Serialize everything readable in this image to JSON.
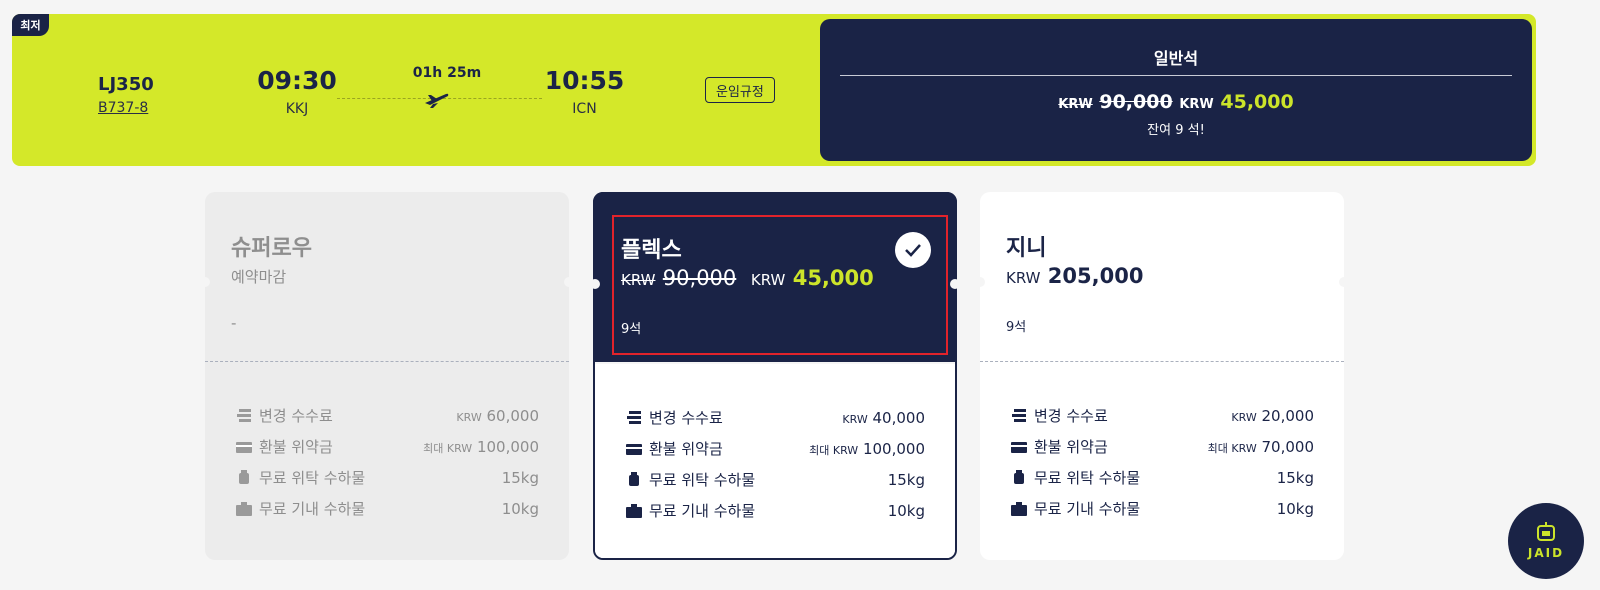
{
  "flight": {
    "badge": "최저",
    "flight_no": "LJ350",
    "aircraft": "B737-8",
    "departure": {
      "time": "09:30",
      "code": "KKJ"
    },
    "arrival": {
      "time": "10:55",
      "code": "ICN"
    },
    "duration": "01h 25m",
    "rules_label": "운임규정"
  },
  "economy": {
    "title": "일반석",
    "currency": "KRW",
    "original_price": "90,000",
    "sale_price": "45,000",
    "seats_left": "잔여 9 석!"
  },
  "fares": [
    {
      "name": "슈퍼로우",
      "status": "예약마감",
      "seats": "-",
      "rows": [
        {
          "label": "변경 수수료",
          "prefix": "",
          "currency": "KRW",
          "value": "60,000"
        },
        {
          "label": "환불 위약금",
          "prefix": "최대 ",
          "currency": "KRW",
          "value": "100,000"
        },
        {
          "label": "무료 위탁 수하물",
          "prefix": "",
          "currency": "",
          "value": "15kg"
        },
        {
          "label": "무료 기내 수하물",
          "prefix": "",
          "currency": "",
          "value": "10kg"
        }
      ]
    },
    {
      "name": "플렉스",
      "currency": "KRW",
      "original_price": "90,000",
      "sale_price": "45,000",
      "seats": "9석",
      "selected": true,
      "rows": [
        {
          "label": "변경 수수료",
          "prefix": "",
          "currency": "KRW",
          "value": "40,000"
        },
        {
          "label": "환불 위약금",
          "prefix": "최대 ",
          "currency": "KRW",
          "value": "100,000"
        },
        {
          "label": "무료 위탁 수하물",
          "prefix": "",
          "currency": "",
          "value": "15kg"
        },
        {
          "label": "무료 기내 수하물",
          "prefix": "",
          "currency": "",
          "value": "10kg"
        }
      ]
    },
    {
      "name": "지니",
      "currency": "KRW",
      "price": "205,000",
      "seats": "9석",
      "rows": [
        {
          "label": "변경 수수료",
          "prefix": "",
          "currency": "KRW",
          "value": "20,000"
        },
        {
          "label": "환불 위약금",
          "prefix": "최대 ",
          "currency": "KRW",
          "value": "70,000"
        },
        {
          "label": "무료 위탁 수하물",
          "prefix": "",
          "currency": "",
          "value": "15kg"
        },
        {
          "label": "무료 기내 수하물",
          "prefix": "",
          "currency": "",
          "value": "10kg"
        }
      ]
    }
  ],
  "chatbot": {
    "label": "JAID"
  },
  "icons": [
    "change-fee-icon",
    "refund-icon",
    "checked-baggage-icon",
    "carry-on-icon",
    "airplane-icon",
    "check-icon"
  ],
  "colors": {
    "accent_lime": "#d4e829",
    "navy": "#1a2346",
    "selection_outline": "#e1232b"
  }
}
